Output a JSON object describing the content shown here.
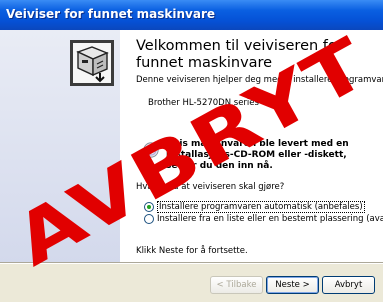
{
  "window": {
    "title": "Veiviser for funnet maskinvare"
  },
  "content": {
    "heading": "Velkommen til veiviseren for funnet maskinvare",
    "intro": "Denne veiviseren hjelper deg med å installere programvare for:",
    "device": "Brother HL-5270DN series",
    "cd_hint": "Hvis maskinvaren ble levert med en installasjons-CD-ROM eller -diskett, setter du den inn nå.",
    "question": "Hva vil du at veiviseren skal gjøre?",
    "options": [
      {
        "label": "Installere programvaren automatisk (anbefales)",
        "selected": true
      },
      {
        "label": "Installere fra en liste eller en bestemt plassering (avansert)",
        "selected": false
      }
    ],
    "footer": "Klikk Neste for å fortsette."
  },
  "buttons": {
    "back": "< Tilbake",
    "next": "Neste >",
    "cancel": "Avbryt"
  },
  "watermark": {
    "text": "AVBRYT",
    "color": "#e10000"
  },
  "icons": [
    "hardware-install-icon",
    "cd-icon"
  ]
}
